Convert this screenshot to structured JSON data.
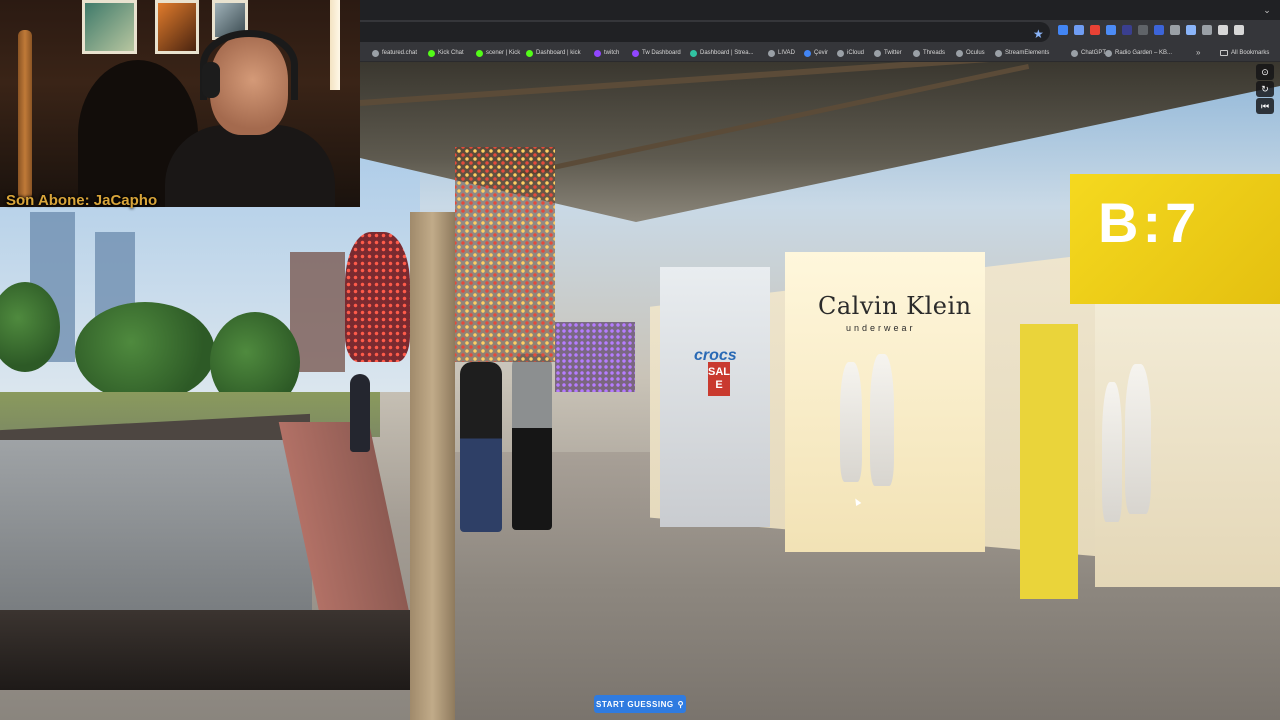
{
  "browser": {
    "bookmarks": [
      {
        "label": "featured.chat",
        "color": "#9aa0a6"
      },
      {
        "label": "Kick Chat",
        "color": "#53fc18"
      },
      {
        "label": "scener | Kick",
        "color": "#53fc18"
      },
      {
        "label": "Dashboard | kick",
        "color": "#53fc18"
      },
      {
        "label": "twitch",
        "color": "#9146ff"
      },
      {
        "label": "Tw Dashboard",
        "color": "#9146ff"
      },
      {
        "label": "Dashboard | Strea...",
        "color": "#31c3a2"
      },
      {
        "label": "LIVAD",
        "color": "#9aa0a6"
      },
      {
        "label": "Çevir",
        "color": "#4285f4"
      },
      {
        "label": "iCloud",
        "color": "#9aa0a6"
      },
      {
        "label": "Twitter",
        "color": "#9aa0a6"
      },
      {
        "label": "Threads",
        "color": "#9aa0a6"
      },
      {
        "label": "Oculus",
        "color": "#9aa0a6"
      },
      {
        "label": "StreamElements",
        "color": "#9aa0a6"
      },
      {
        "label": "ChatGPT",
        "color": "#9aa0a6"
      },
      {
        "label": "Radio Garden – KB...",
        "color": "#9aa0a6"
      }
    ],
    "overflow_label": "»",
    "all_bookmarks_label": "All Bookmarks",
    "window_menu_label": "⌄",
    "star_icon": "★",
    "extension_colors": [
      "#4285f4",
      "#6f9cf2",
      "#e94235",
      "#4c8bf5",
      "#3a3f8f",
      "#5f6368",
      "#3c64d8",
      "#9aa0a6",
      "#8ab4f8",
      "#9aa0a6",
      "#d7d7d7",
      "#d7d7d7"
    ]
  },
  "webcam": {
    "last_guess_text": "Son Abone: JaCapho"
  },
  "streetview": {
    "signs": {
      "calvin_klein": "Calvin Klein",
      "calvin_klein_sub": "underwear",
      "crocs": "crocs",
      "b7": "B:7",
      "sale": "SALE"
    }
  },
  "game": {
    "controls": [
      {
        "name": "compass-button",
        "glyph": "⊙"
      },
      {
        "name": "refresh-button",
        "glyph": "↻"
      },
      {
        "name": "return-to-start-button",
        "glyph": "⏮"
      }
    ],
    "start_guessing_label": "START GUESSING",
    "pin_icon": "⚲"
  }
}
